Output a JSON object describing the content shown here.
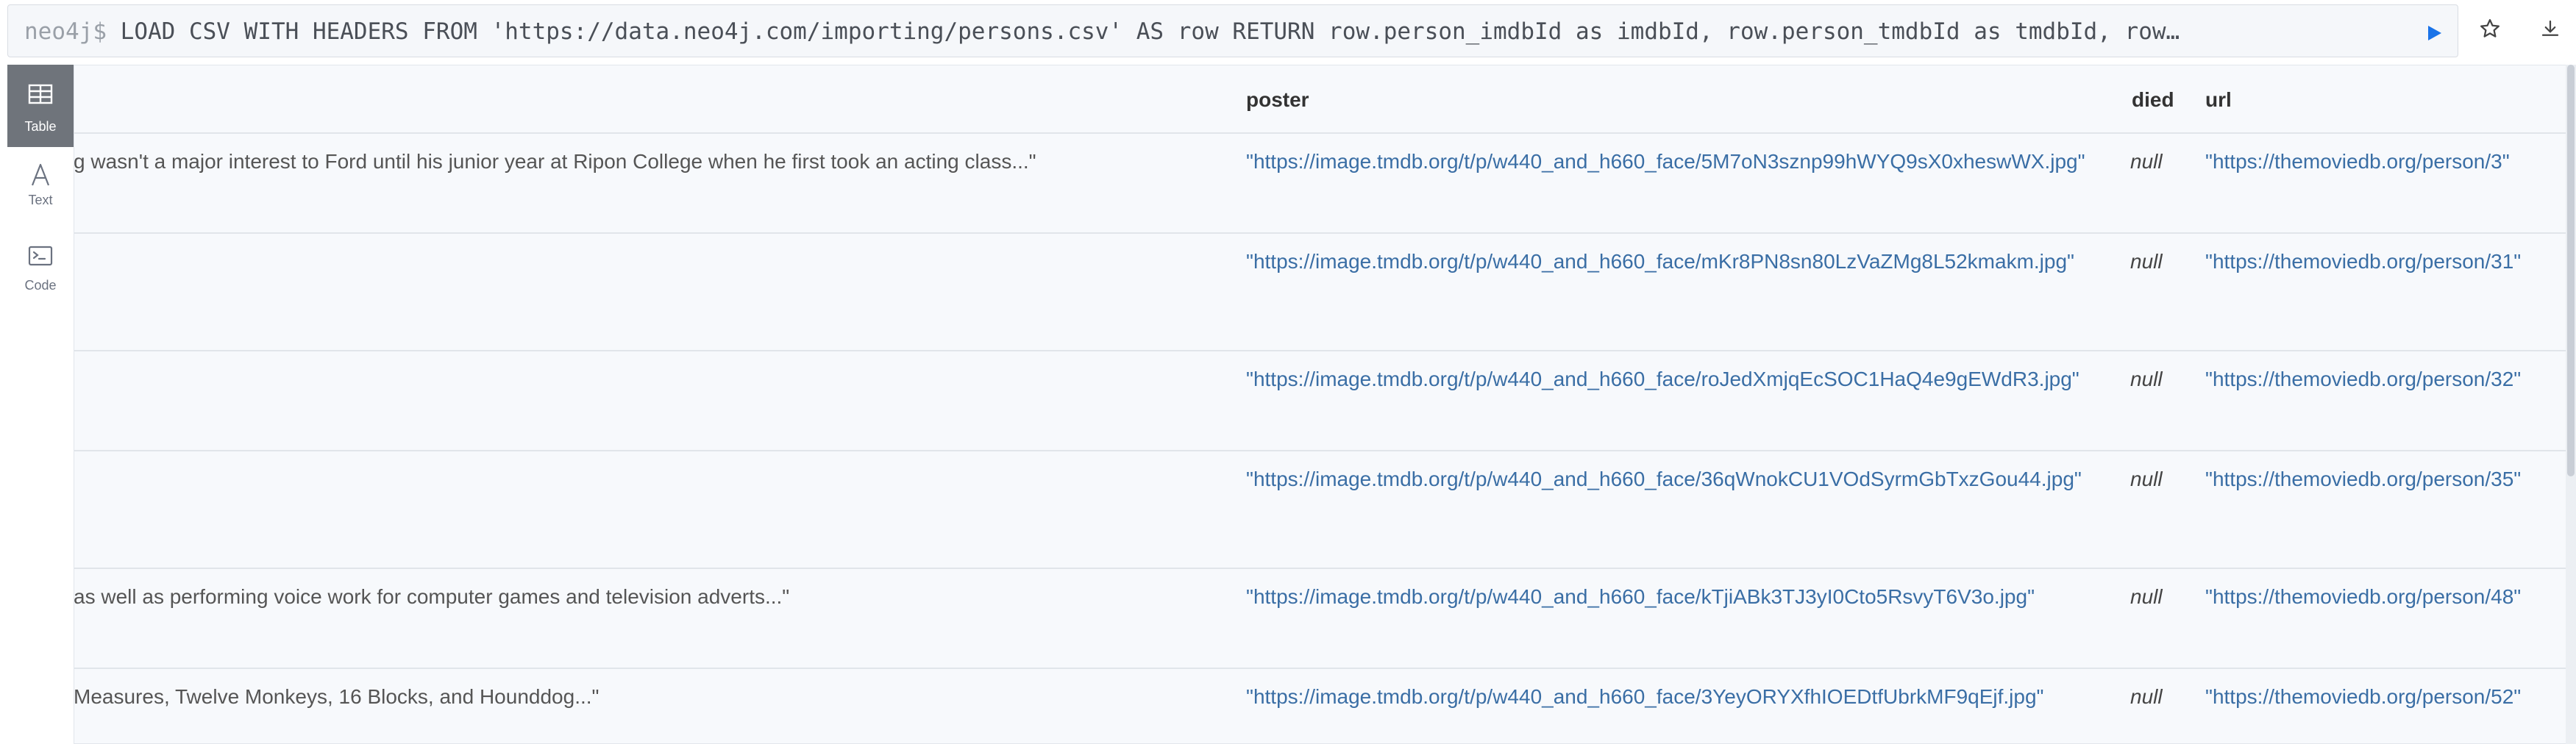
{
  "editor": {
    "prompt": "neo4j$",
    "query": "LOAD CSV WITH HEADERS FROM 'https://data.neo4j.com/importing/persons.csv' AS row RETURN row.person_imdbId as imdbId, row.person_tmdbId as tmdbId, row…"
  },
  "toolbar": {
    "run_icon": "play-icon",
    "favorite_icon": "star-icon",
    "download_icon": "download-icon",
    "accent": "#1a73e8"
  },
  "sidebar": {
    "items": [
      {
        "label": "Table",
        "icon": "table-icon",
        "active": true
      },
      {
        "label": "Text",
        "icon": "text-icon",
        "active": false
      },
      {
        "label": "Code",
        "icon": "code-icon",
        "active": false
      }
    ]
  },
  "table": {
    "columns": [
      "poster",
      "died",
      "url"
    ],
    "rows": [
      {
        "bio": "g wasn't a major interest to Ford until his junior year at Ripon College when he first took an acting class...\"",
        "poster": "\"https://image.tmdb.org/t/p/w440_and_h660_face/5M7oN3sznp99hWYQ9sX0xheswWX.jpg\"",
        "died": "null",
        "url": "\"https://themoviedb.org/person/3\""
      },
      {
        "bio": "",
        "poster": "\"https://image.tmdb.org/t/p/w440_and_h660_face/mKr8PN8sn80LzVaZMg8L52kmakm.jpg\"",
        "died": "null",
        "url": "\"https://themoviedb.org/person/31\""
      },
      {
        "bio": "",
        "poster": "\"https://image.tmdb.org/t/p/w440_and_h660_face/roJedXmjqEcSOC1HaQ4e9gEWdR3.jpg\"",
        "died": "null",
        "url": "\"https://themoviedb.org/person/32\""
      },
      {
        "bio": "",
        "poster": "\"https://image.tmdb.org/t/p/w440_and_h660_face/36qWnokCU1VOdSyrmGbTxzGou44.jpg\"",
        "died": "null",
        "url": "\"https://themoviedb.org/person/35\""
      },
      {
        "bio": "as well as performing voice work for computer games and television adverts...\"",
        "poster": "\"https://image.tmdb.org/t/p/w440_and_h660_face/kTjiABk3TJ3yI0Cto5RsvyT6V3o.jpg\"",
        "died": "null",
        "url": "\"https://themoviedb.org/person/48\""
      },
      {
        "bio": "Measures, Twelve Monkeys, 16 Blocks, and Hounddog...\"",
        "poster": "\"https://image.tmdb.org/t/p/w440_and_h660_face/3YeyORYXfhIOEDtfUbrkMF9qEjf.jpg\"",
        "died": "null",
        "url": "\"https://themoviedb.org/person/52\""
      }
    ]
  }
}
